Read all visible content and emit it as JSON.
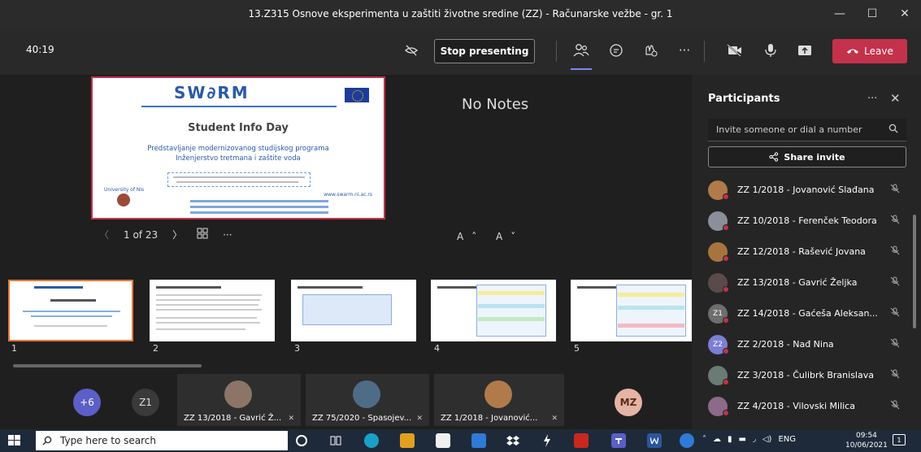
{
  "window": {
    "title": "13.Z315 Osnove eksperimenta u zaštiti životne sredine (ZZ) - Računarske vežbe - gr. 1",
    "minimize": "—",
    "maximize": "☐",
    "close": "✕"
  },
  "controls": {
    "timer": "40:19",
    "stop_presenting": "Stop presenting",
    "more": "···",
    "leave": "Leave"
  },
  "slide": {
    "logo": "SW∂RM",
    "headline": "Student Info Day",
    "subtitle_1": "Predstavljanje modernizovanog studijskog programa",
    "subtitle_2": "Inženjerstvo tretmana i zaštite voda",
    "university": "University of Nis",
    "site": "www.swarm.ni.ac.rs"
  },
  "presenter": {
    "no_notes": "No Notes",
    "page_indicator": "1 of 23",
    "prev": "〈",
    "next": "〉",
    "more": "···",
    "font_controls": "A˄ A˅"
  },
  "thumbnails": [
    {
      "num": "1",
      "selected": true
    },
    {
      "num": "2",
      "selected": false
    },
    {
      "num": "3",
      "selected": false
    },
    {
      "num": "4",
      "selected": false
    },
    {
      "num": "5",
      "selected": false
    }
  ],
  "strip": {
    "overflow": "+6",
    "z1": "Z1",
    "tile_1": "ZZ 13/2018 - Gavrić Ž...",
    "tile_2": "ZZ 75/2020 - Spasojev...",
    "tile_3": "ZZ 1/2018 - Jovanović...",
    "mz": "MZ"
  },
  "panel": {
    "title": "Participants",
    "more": "···",
    "close": "✕",
    "invite_placeholder": "Invite someone or dial a number",
    "share_invite": "Share invite",
    "participants": [
      {
        "name": "ZZ 1/2018 - Jovanović Slađana",
        "initials": "",
        "color": "#b07a4a"
      },
      {
        "name": "ZZ 10/2018 - Ferenček Teodora",
        "initials": "",
        "color": "#8a8f9a"
      },
      {
        "name": "ZZ 12/2018 - Rašević Jovana",
        "initials": "",
        "color": "#a8743e"
      },
      {
        "name": "ZZ 13/2018 - Gavrić Željka",
        "initials": "",
        "color": "#5a4a4a"
      },
      {
        "name": "ZZ 14/2018 - Gaćeša Aleksan...",
        "initials": "Z1",
        "color": "#6e6e6e"
      },
      {
        "name": "ZZ 2/2018 - Nađ Nina",
        "initials": "Z2",
        "color": "#7b7fd4"
      },
      {
        "name": "ZZ 3/2018 - Čulibrk Branislava",
        "initials": "",
        "color": "#6a7a74"
      },
      {
        "name": "ZZ 4/2018 - Vilovski Milica",
        "initials": "",
        "color": "#8c6a8a"
      }
    ]
  },
  "taskbar": {
    "search_placeholder": "Type here to search",
    "lang": "ENG",
    "time": "09:54",
    "date": "10/06/2021",
    "notif_count": "1"
  }
}
